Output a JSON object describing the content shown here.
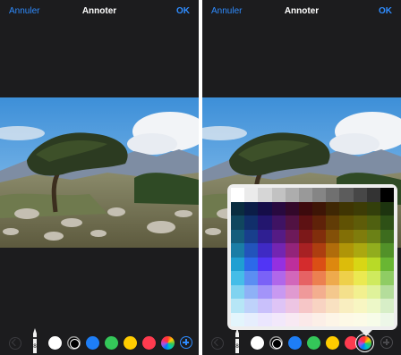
{
  "screens": [
    {
      "cancel_label": "Annuler",
      "title": "Annoter",
      "ok_label": "OK"
    },
    {
      "cancel_label": "Annuler",
      "title": "Annoter",
      "ok_label": "OK"
    }
  ],
  "pen": {
    "label": "8"
  },
  "swatches": [
    "#ffffff",
    "#000000",
    "#1e7ef6",
    "#34c759",
    "#ffcc00",
    "#ff3b4f",
    "multicolor"
  ],
  "palette": {
    "grays": [
      "#ffffff",
      "#ebebeb",
      "#d6d6d6",
      "#c2c2c2",
      "#adadad",
      "#999999",
      "#858585",
      "#707070",
      "#5c5c5c",
      "#474747",
      "#333333",
      "#000000"
    ],
    "hues": [
      [
        "#0a2c3f",
        "#0b1d47",
        "#150d48",
        "#28093f",
        "#33082a",
        "#3d0a0d",
        "#3e1506",
        "#3f2704",
        "#3f3503",
        "#3d3c06",
        "#333f0b",
        "#1d340f"
      ],
      [
        "#10465e",
        "#112f6b",
        "#23166e",
        "#3f1363",
        "#511242",
        "#5d1113",
        "#5f2209",
        "#613c06",
        "#605204",
        "#5e5c09",
        "#4f6010",
        "#2e5016"
      ],
      [
        "#145d7c",
        "#183f8c",
        "#2f1f92",
        "#551b85",
        "#6d1a5a",
        "#7c1819",
        "#812e0c",
        "#835008",
        "#826f06",
        "#7f7c0c",
        "#6b8116",
        "#3d6c1e"
      ],
      [
        "#1a7da6",
        "#2254bb",
        "#3f2ac4",
        "#7325b2",
        "#93247a",
        "#a72123",
        "#ad3e10",
        "#b06c0b",
        "#af9508",
        "#aba810",
        "#91ad1e",
        "#529129"
      ],
      [
        "#1f9fd2",
        "#2c6ae9",
        "#5135f5",
        "#9530e0",
        "#bd2f9c",
        "#d42c2d",
        "#db4f15",
        "#dd880f",
        "#dcbc0b",
        "#d8d615",
        "#b8da27",
        "#69b633"
      ],
      [
        "#45bde8",
        "#5b8ef2",
        "#7a62f7",
        "#b067ea",
        "#d267ba",
        "#e66264",
        "#ec8050",
        "#eeaa4d",
        "#eed04a",
        "#ebe951",
        "#cfea5e",
        "#8fcc64"
      ],
      [
        "#80d3f0",
        "#8eb1f6",
        "#a394f9",
        "#c899f1",
        "#e09ad0",
        "#ef999a",
        "#f3ae8f",
        "#f4c88d",
        "#f4e08b",
        "#f2f08f",
        "#dff29a",
        "#b4dd9b"
      ],
      [
        "#b6e6f6",
        "#bed2fa",
        "#c9c0fb",
        "#dec4f6",
        "#edc5e3",
        "#f6c6c7",
        "#f8d3c2",
        "#f9e1c1",
        "#f9eec0",
        "#f8f6c2",
        "#edf8c8",
        "#d7eec7"
      ],
      [
        "#e3f5fc",
        "#e6eefd",
        "#ebe6fe",
        "#f2e8fb",
        "#f8e9f3",
        "#fbe9e9",
        "#fcefe7",
        "#fdf5e7",
        "#fdf9e6",
        "#fcfbe7",
        "#f7fce9",
        "#edf7e8"
      ]
    ]
  }
}
